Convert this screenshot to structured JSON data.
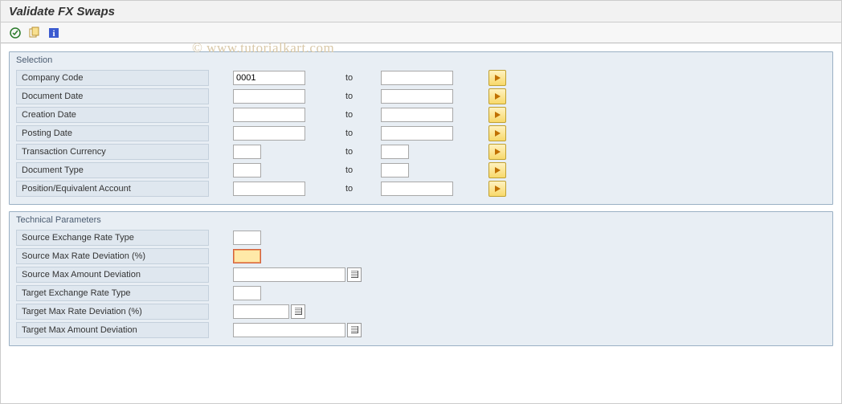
{
  "title": "Validate FX Swaps",
  "watermark": "© www.tutorialkart.com",
  "toolbar": {
    "icons": [
      "execute",
      "variant",
      "info"
    ]
  },
  "selection": {
    "title": "Selection",
    "to_label": "to",
    "fields": [
      {
        "label": "Company Code",
        "from": "0001",
        "to": "",
        "from_w": "med",
        "to_w": "med"
      },
      {
        "label": "Document Date",
        "from": "",
        "to": "",
        "from_w": "med",
        "to_w": "med"
      },
      {
        "label": "Creation Date",
        "from": "",
        "to": "",
        "from_w": "med",
        "to_w": "med"
      },
      {
        "label": "Posting Date",
        "from": "",
        "to": "",
        "from_w": "med",
        "to_w": "med"
      },
      {
        "label": "Transaction Currency",
        "from": "",
        "to": "",
        "from_w": "small",
        "to_w": "small"
      },
      {
        "label": "Document Type",
        "from": "",
        "to": "",
        "from_w": "small",
        "to_w": "small"
      },
      {
        "label": "Position/Equivalent Account",
        "from": "",
        "to": "",
        "from_w": "med",
        "to_w": "med"
      }
    ]
  },
  "tech": {
    "title": "Technical Parameters",
    "fields": [
      {
        "label": "Source Exchange Rate Type",
        "w": "small",
        "f4": false,
        "highlight": false
      },
      {
        "label": "Source Max Rate Deviation (%)",
        "w": "small",
        "f4": false,
        "highlight": true
      },
      {
        "label": "Source Max Amount Deviation",
        "w": "l140",
        "f4": true,
        "highlight": false
      },
      {
        "label": "Target Exchange Rate Type",
        "w": "small",
        "f4": false,
        "highlight": false
      },
      {
        "label": "Target Max Rate Deviation (%)",
        "w": "small_f4only",
        "f4": true,
        "highlight": false
      },
      {
        "label": "Target Max Amount Deviation",
        "w": "l140",
        "f4": true,
        "highlight": false
      }
    ]
  }
}
